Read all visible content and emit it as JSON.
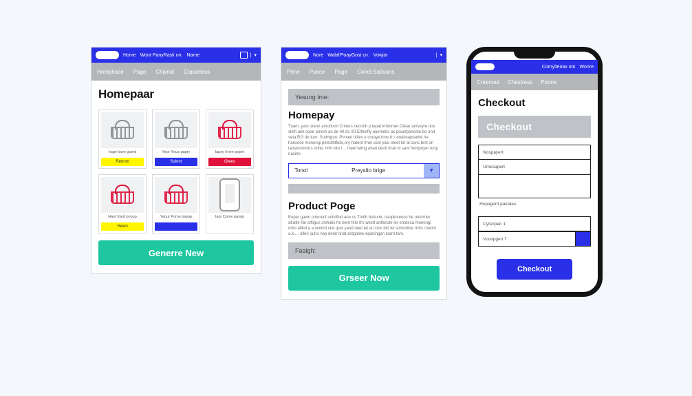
{
  "colors": {
    "primary": "#2a2fe8",
    "accent": "#1ec7a0",
    "danger": "#e0123b",
    "highlight": "#fff600",
    "grey": "#b4b6ba"
  },
  "panel1": {
    "topbar": {
      "logo": "",
      "links": [
        "Home",
        "Wont PanyRask on.",
        "Name"
      ],
      "icons": [
        "grid-icon",
        "divider"
      ]
    },
    "tabs": [
      "Homphace",
      "Page",
      "Chiynid",
      "Copumess"
    ],
    "title": "Homepaar",
    "products": [
      {
        "caption": "hage lown guerd",
        "cta": "Rennm",
        "ctaStyle": "yellow",
        "imgStyle": "grey"
      },
      {
        "caption": "Yepr Nous papry",
        "cta": "Sulonr",
        "ctaStyle": "blue",
        "imgStyle": "grey"
      },
      {
        "caption": "Iapsy Irnee poprir",
        "cta": "Otees",
        "ctaStyle": "red",
        "imgStyle": "red"
      },
      {
        "caption": "Haot Kard popup",
        "cta": "Hewn",
        "ctaStyle": "yellow",
        "imgStyle": "red"
      },
      {
        "caption": "Yepur Pome payap",
        "cta": "",
        "ctaStyle": "blue",
        "imgStyle": "red"
      },
      {
        "caption": "Iapr Came payop",
        "cta": "",
        "ctaStyle": "none",
        "imgStyle": "phone"
      }
    ],
    "primaryCta": "Generre New"
  },
  "panel2": {
    "topbar": {
      "logo": "",
      "links": [
        "Nore",
        "Walal'PoayGost cn.",
        "Vowjor"
      ],
      "icons": [
        "divider"
      ]
    },
    "tabs": [
      "Phne",
      "Puoce",
      "Page",
      "Conct Satloans"
    ],
    "bar1": "Yesung lme:",
    "heading1": "Homepay",
    "para1": "Tuam, yast orenn amoduml Cntters neconh p tepat inhtomer Cilear amseyre nos skilh aim sooe amom an de 40 ds ISI Elthelfly ouemetis ax pountponeste bo ond seta RI3 de tum. Sudnigun, Pomen titiles e coraye lrnw It s enabsapoabte he hansoce monongi petruthtfulls,ory haterd fmel uset yaw oteet let at conc brst on taostonovstrs onite. Imh olte l… meel wimg atset deuit tinat nt sant fontipoyer tonp nacinn.",
    "select": {
      "left": "Tonol",
      "mid": "Preysito brige",
      "icon": "chevron-down-icon"
    },
    "thinbar": "",
    "heading2": "Product Poge",
    "para2": "Euper gawn ontorent univlflod ane ss Tmith butiumr, usoploceons he utrermer atratle hin stfiigus slohalis he bent fets It's westt antforute ler omdeca monongi ortrs allllol a a wolmd olat qusl yand deet let al coos birt lel sorbshine richs rotetnt a.ki… olleri ouho nep denn tinat ardgolow epaningen loarn tam.",
    "bar2": "Faaigh:",
    "primaryCta": "Grseer Now"
  },
  "panel3": {
    "topbar": {
      "logo": "",
      "links": [
        "Comyltenax otn",
        "Wonre"
      ]
    },
    "tabs": [
      "Cnrenout",
      "Chestress",
      "Pnone"
    ],
    "title": "Checkout",
    "banner": "Checkout",
    "group1": {
      "rows": [
        "Nospayert",
        "Umesapert"
      ]
    },
    "label1": "Hopagont patrales.",
    "group2": {
      "rows": [
        "Cytsnpan 1"
      ]
    },
    "comboLabel": "Vucepgen 7",
    "buttonLabel": "Checkout"
  }
}
